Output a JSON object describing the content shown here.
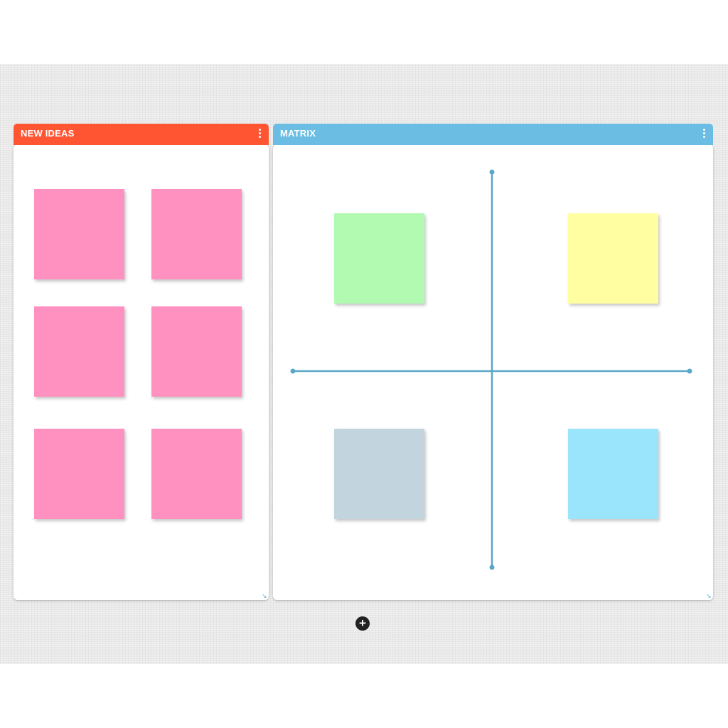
{
  "board": {
    "panels": [
      {
        "title": "NEW IDEAS",
        "header_color": "#ff5533",
        "notes": [
          {
            "color": "#ff91c1"
          },
          {
            "color": "#ff91c1"
          },
          {
            "color": "#ff91c1"
          },
          {
            "color": "#ff91c1"
          },
          {
            "color": "#ff91c1"
          },
          {
            "color": "#ff91c1"
          }
        ]
      },
      {
        "title": "MATRIX",
        "header_color": "#6bbde3",
        "axis_color": "#5aa7c8",
        "notes": [
          {
            "color": "#b2f9b1"
          },
          {
            "color": "#fffea0"
          },
          {
            "color": "#c2d5df"
          },
          {
            "color": "#9ae4fc"
          }
        ]
      }
    ],
    "add_button_symbol": "+",
    "icons": {
      "panel_menu": "vertical-ellipsis-icon",
      "resize": "resize-corner-icon",
      "add": "plus-circle-icon"
    }
  }
}
